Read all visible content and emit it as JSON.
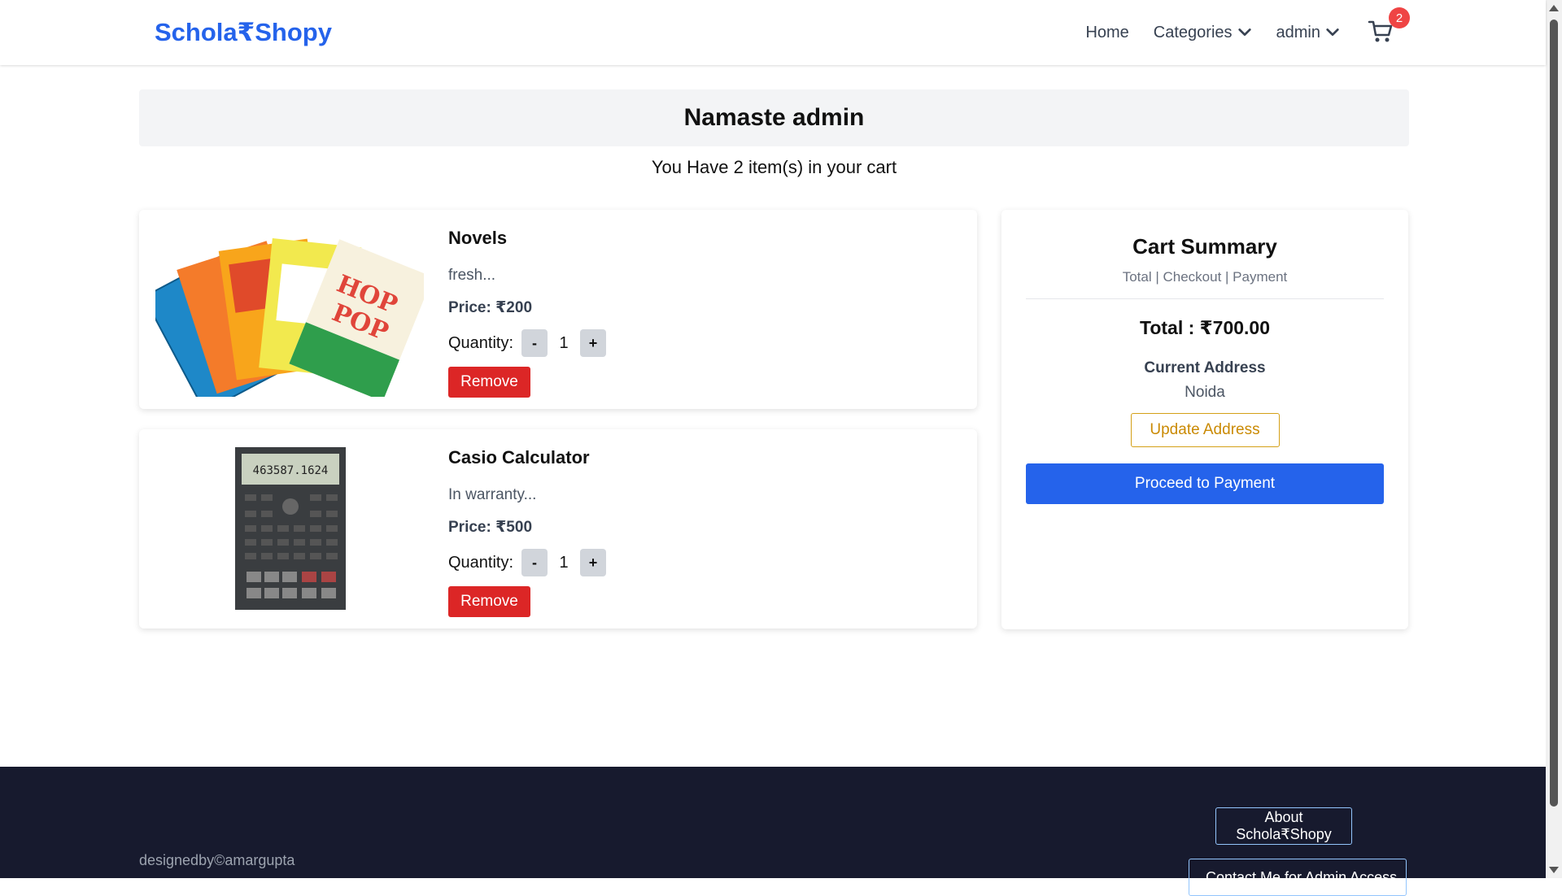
{
  "navbar": {
    "brand": "Schola₹Shopy",
    "links": {
      "home": "Home",
      "categories": "Categories",
      "user": "admin"
    },
    "cart_badge": "2"
  },
  "greeting": "Namaste admin",
  "cart_count_text": "You Have 2 item(s) in your cart",
  "items": [
    {
      "name": "Novels",
      "description": "fresh...",
      "price": "Price: ₹200",
      "quantity_label": "Quantity:",
      "quantity": "1",
      "minus": "-",
      "plus": "+",
      "remove": "Remove"
    },
    {
      "name": "Casio Calculator",
      "description": "In warranty...",
      "price": "Price: ₹500",
      "quantity_label": "Quantity:",
      "quantity": "1",
      "minus": "-",
      "plus": "+",
      "remove": "Remove"
    }
  ],
  "summary": {
    "title": "Cart Summary",
    "subtitle": "Total | Checkout | Payment",
    "total": "Total : ₹700.00",
    "address_label": "Current Address",
    "address_value": "Noida",
    "update_button": "Update Address",
    "pay_button": "Proceed to Payment"
  },
  "footer": {
    "credit": "designedby©amargupta",
    "about_button": "About Schola₹Shopy",
    "contact_button": "Contact Me for Admin Access"
  },
  "colors": {
    "brand": "#2563eb",
    "remove": "#dc2626",
    "pay": "#2563eb",
    "update_border": "#d4a017",
    "footer_bg": "#171a2e",
    "badge": "#ef4444"
  }
}
